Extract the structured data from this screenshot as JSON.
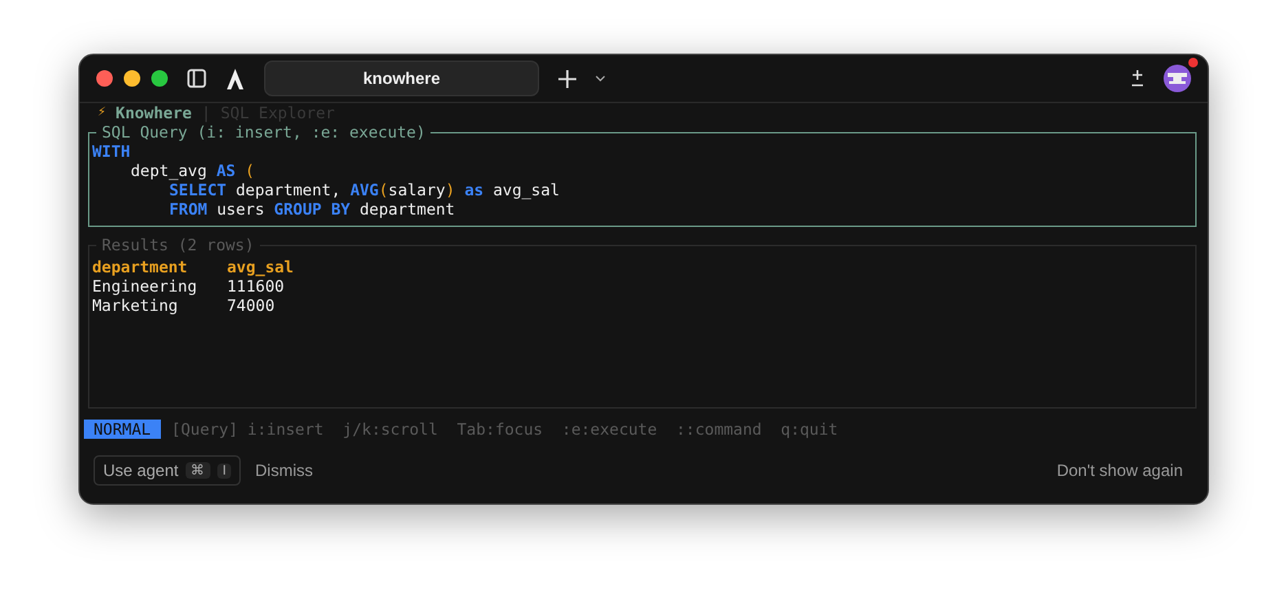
{
  "window": {
    "title": "knowhere"
  },
  "header": {
    "icon": "⚡",
    "app": "Knowhere",
    "separator": "|",
    "view": "SQL Explorer"
  },
  "query_panel": {
    "title": "SQL Query (i: insert, :e: execute)",
    "lines": [
      {
        "tokens": [
          {
            "kind": "keyword",
            "text": "WITH"
          }
        ],
        "children": [
          {
            "tokens": [
              {
                "kind": "plain",
                "text": "dept_avg "
              },
              {
                "kind": "keyword",
                "text": "AS"
              },
              {
                "kind": "paren",
                "text": " ("
              }
            ],
            "children": [
              {
                "tokens": [
                  {
                    "kind": "keyword",
                    "text": "SELECT"
                  },
                  {
                    "kind": "plain",
                    "text": " department, "
                  },
                  {
                    "kind": "keyword",
                    "text": "AVG"
                  },
                  {
                    "kind": "paren",
                    "text": "("
                  },
                  {
                    "kind": "plain",
                    "text": "salary"
                  },
                  {
                    "kind": "paren",
                    "text": ")"
                  },
                  {
                    "kind": "keyword",
                    "text": " as"
                  },
                  {
                    "kind": "plain",
                    "text": " avg_sal"
                  }
                ]
              },
              {
                "tokens": [
                  {
                    "kind": "keyword",
                    "text": "FROM"
                  },
                  {
                    "kind": "plain",
                    "text": " users "
                  },
                  {
                    "kind": "keyword",
                    "text": "GROUP BY"
                  },
                  {
                    "kind": "plain",
                    "text": " department"
                  }
                ]
              }
            ]
          }
        ]
      }
    ]
  },
  "results_panel": {
    "title": "Results (2 rows)",
    "columns": [
      "department",
      "avg_sal"
    ],
    "rows": [
      [
        "Engineering",
        "111600"
      ],
      [
        "Marketing",
        "74000"
      ]
    ]
  },
  "status_bar": {
    "mode": "NORMAL",
    "hints": "[Query] i:insert  j/k:scroll  Tab:focus  :e:execute  ::command  q:quit"
  },
  "prompt_bar": {
    "button": "Use agent",
    "keys": [
      "⌘",
      "I"
    ],
    "dismiss": "Dismiss",
    "dont_show": "Don't show again"
  }
}
